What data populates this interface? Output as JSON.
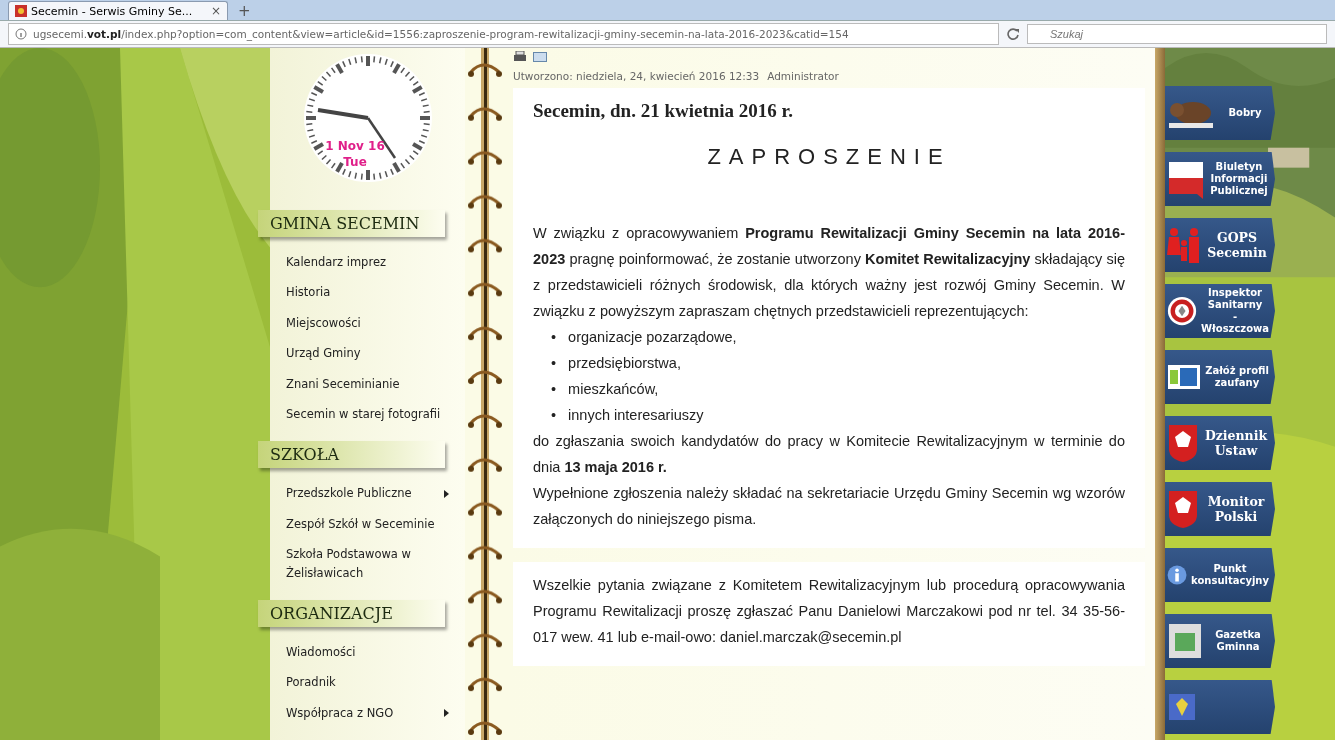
{
  "browser": {
    "tab": {
      "title": "Secemin - Serwis Gminy Se...",
      "close": "×",
      "selected": true
    },
    "new_tab": "+",
    "url": "ugsecemi.**vot.pl**/index.php?option=com_content&view=article&id=1556:zaproszenie-program-rewitalizacji-gminy-secemin-na-lata-2016-2023&catid=154",
    "search": {
      "placeholder": "Szukaj"
    }
  },
  "clock": {
    "date": "1 Nov 16",
    "day": "Tue"
  },
  "menus": [
    {
      "title": "GMINA SECEMIN",
      "items": [
        {
          "label": "Kalendarz imprez",
          "has_submenu": false
        },
        {
          "label": "Historia",
          "has_submenu": false
        },
        {
          "label": "Miejscowości",
          "has_submenu": false
        },
        {
          "label": "Urząd Gminy",
          "has_submenu": false
        },
        {
          "label": "Znani Seceminianie",
          "has_submenu": false
        },
        {
          "label": "Secemin w starej fotografii",
          "has_submenu": false
        }
      ]
    },
    {
      "title": "SZKOŁA",
      "items": [
        {
          "label": "Przedszkole Publiczne",
          "has_submenu": true
        },
        {
          "label": "Zespół Szkół w Seceminie",
          "has_submenu": false
        },
        {
          "label": "Szkoła Podstawowa w Żelisławicach",
          "has_submenu": false
        }
      ]
    },
    {
      "title": "ORGANIZACJE",
      "items": [
        {
          "label": "Wiadomości",
          "has_submenu": false
        },
        {
          "label": "Poradnik",
          "has_submenu": false
        },
        {
          "label": "Współpraca z NGO",
          "has_submenu": true
        }
      ]
    }
  ],
  "article": {
    "meta": "Utworzono: niedziela, 24, kwiecień 2016 12:33",
    "author": "Administrator",
    "place_date": "Secemin, dn. 21 kwietnia 2016 r.",
    "heading": "ZAPROSZENIE",
    "intro": "W związku z opracowywaniem **Programu Rewitalizacji Gminy Secemin na lata 2016-2023** pragnę poinformować, że zostanie utworzony **Komitet Rewitalizacyjny** składający się z przedstawicieli różnych środowisk, dla których ważny jest rozwój Gminy Secemin. W związku z powyższym zapraszam chętnych przedstawicieli reprezentujących:",
    "list": [
      {
        "marker": "•",
        "text": "organizacje pozarządowe,"
      },
      {
        "marker": "•",
        "text": "przedsiębiorstwa,"
      },
      {
        "marker": "•",
        "text": "mieszkańców,"
      },
      {
        "marker": "•",
        "text": "innych interesariuszy"
      }
    ],
    "deadline": "do zgłaszania swoich kandydatów do pracy w Komitecie Rewitalizacyjnym w terminie do dnia **13 maja 2016 r.**",
    "submission": "Wypełnione zgłoszenia należy składać na sekretariacie Urzędu Gminy Secemin wg wzorów załączonych  do niniejszego pisma.",
    "contact": "Wszelkie pytania związane z Komitetem Rewitalizacyjnym lub procedurą opracowywania Programu Rewitalizacji proszę zgłaszać Panu Danielowi Marczakowi pod nr tel. 34 35-56-017 wew. 41 lub  e-mail-owo: daniel.marczak@secemin.pl"
  },
  "banners": [
    {
      "lines": [
        "Bobry"
      ],
      "serif": false
    },
    {
      "lines": [
        "Biuletyn",
        "Informacji",
        "Publicznej"
      ],
      "serif": false
    },
    {
      "lines": [
        "GOPS",
        "Secemin"
      ],
      "serif": true
    },
    {
      "lines": [
        "Inspektor",
        "Sanitarny",
        "- Włoszczowa"
      ],
      "serif": false
    },
    {
      "lines": [
        "Załóż profil",
        "zaufany"
      ],
      "serif": false
    },
    {
      "lines": [
        "Dziennik",
        "Ustaw"
      ],
      "serif": true
    },
    {
      "lines": [
        "Monitor",
        "Polski"
      ],
      "serif": true
    },
    {
      "lines": [
        "Punkt",
        "konsultacyjny"
      ],
      "serif": false
    },
    {
      "lines": [
        "Gazetka",
        "Gminna"
      ],
      "serif": false
    },
    {
      "kind": "icon_only"
    }
  ]
}
